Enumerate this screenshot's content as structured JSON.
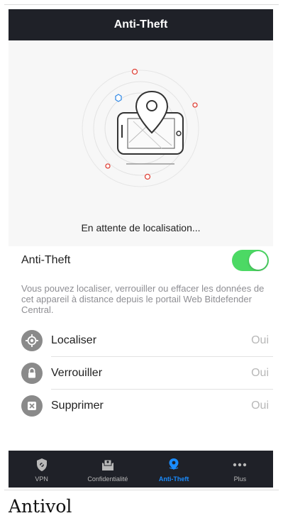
{
  "header": {
    "title": "Anti-Theft"
  },
  "hero": {
    "status_text": "En attente de localisation..."
  },
  "toggle_row": {
    "label": "Anti-Theft",
    "enabled": true,
    "on_color": "#4cd964"
  },
  "description": "Vous pouvez localiser, verrouiller ou effacer les données de cet appareil à distance depuis le portail Web Bitdefender Central.",
  "actions": [
    {
      "name": "Localiser",
      "value": "Oui",
      "icon": "locate-icon"
    },
    {
      "name": "Verrouiller",
      "value": "Oui",
      "icon": "lock-icon"
    },
    {
      "name": "Supprimer",
      "value": "Oui",
      "icon": "wipe-icon"
    }
  ],
  "tabbar": {
    "items": [
      {
        "label": "VPN",
        "icon": "vpn-shield-icon",
        "active": false
      },
      {
        "label": "Confidentialité",
        "icon": "privacy-icon",
        "active": false
      },
      {
        "label": "Anti-Theft",
        "icon": "location-pin-icon",
        "active": true
      },
      {
        "label": "Plus",
        "icon": "more-dots-icon",
        "active": false
      }
    ],
    "active_color": "#1a8cff"
  },
  "caption": "Antivol"
}
